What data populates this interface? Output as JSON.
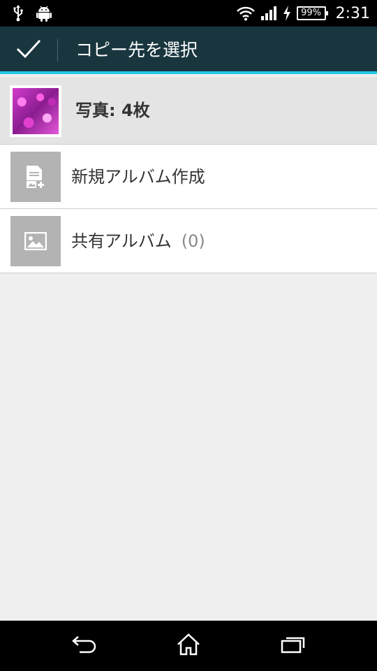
{
  "status_bar": {
    "left_icons": [
      "usb-icon",
      "android-icon"
    ],
    "right_icons": [
      "wifi-icon",
      "signal-icon",
      "charging-icon"
    ],
    "battery": "99%",
    "time": "2:31"
  },
  "action_bar": {
    "confirm_icon": "checkmark-icon",
    "title": "コピー先を選択",
    "accent_color": "#25c5e6",
    "background_color": "#19363f"
  },
  "header": {
    "label": "写真: 4枚"
  },
  "list": {
    "items": [
      {
        "icon": "new-album-icon",
        "label": "新規アルバム作成"
      },
      {
        "icon": "image-icon",
        "label": "共有アルバム",
        "count": "(0)"
      }
    ]
  },
  "nav_bar": {
    "buttons": [
      "back-icon",
      "home-icon",
      "recents-icon"
    ]
  }
}
